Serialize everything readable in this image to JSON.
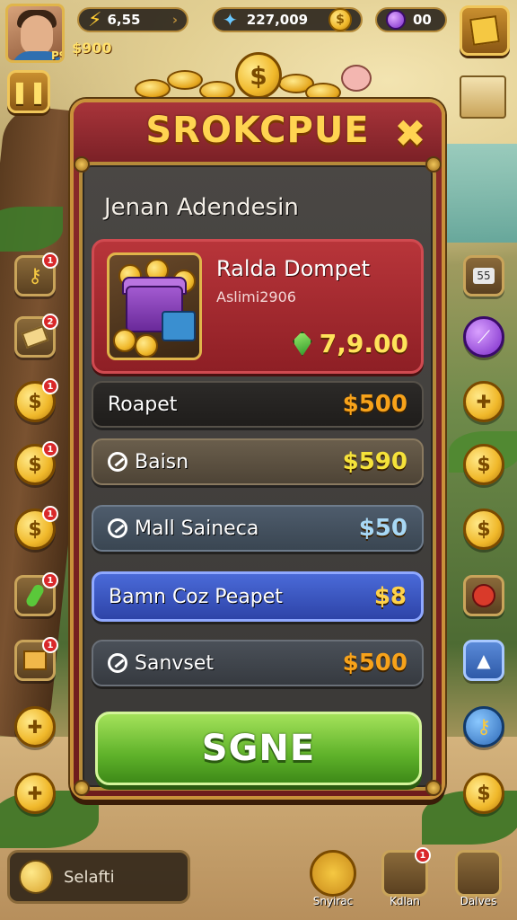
{
  "hud": {
    "player_level": "P9",
    "cash": "$900",
    "energy": "6,55",
    "gold": "227,009",
    "gems": "00"
  },
  "side_left": [
    {
      "icon": "key-icon",
      "badge": "1"
    },
    {
      "icon": "ticket-icon",
      "badge": "2"
    },
    {
      "icon": "coin-icon",
      "badge": "1"
    },
    {
      "icon": "coin-icon",
      "badge": "1"
    },
    {
      "icon": "coin-icon",
      "badge": "1"
    },
    {
      "icon": "pepper-icon",
      "badge": "1"
    },
    {
      "icon": "crate-icon",
      "badge": "1"
    },
    {
      "icon": "map-piece-icon",
      "badge": ""
    },
    {
      "icon": "map-piece-icon",
      "badge": ""
    }
  ],
  "side_right_labels": {
    "calendar": "55"
  },
  "panel": {
    "title": "SROKCPUE",
    "section_title": "Jenan Adendesin",
    "featured": {
      "name": "Ralda Dompet",
      "subtitle": "Aslimi2906",
      "price": "7,9.00"
    },
    "rows": [
      {
        "label": "Roapet",
        "price": "$500",
        "price_color": "#f7a21a"
      },
      {
        "label": "Baisn",
        "price": "$590",
        "price_color": "#f5e23a"
      },
      {
        "label": "Mall Saineca",
        "price": "$50",
        "price_color": "#a8d8f5"
      },
      {
        "label": "Bamn Coz Peapet",
        "price": "$8",
        "price_color": "#ffd24a"
      },
      {
        "label": "Sanvset",
        "price": "$500",
        "price_color": "#f7a21a"
      }
    ],
    "cta_label": "SGNE"
  },
  "bottom": {
    "chat_label": "Selafti",
    "buttons": [
      {
        "label": "Snyirac",
        "badge": ""
      },
      {
        "label": "Kdlan",
        "badge": "1"
      },
      {
        "label": "Dalves",
        "badge": ""
      }
    ]
  },
  "colors": {
    "panel_red": "#8b2a2a",
    "gold_trim": "#c9913a",
    "title_gold": "#ffd451",
    "cta_green": "#5fb22a",
    "selected_row_blue": "#2e44a8"
  }
}
